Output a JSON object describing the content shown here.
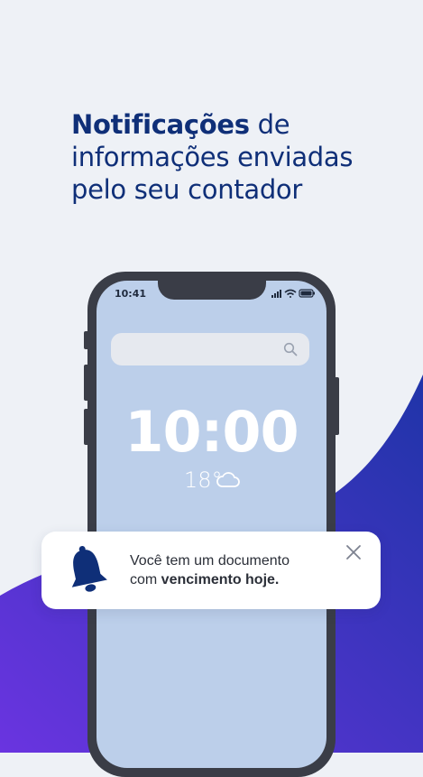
{
  "headline": {
    "bold": "Notificações",
    "rest_first_line": " de",
    "line2": "informações enviadas",
    "line3": "pelo seu contador"
  },
  "phone": {
    "status_time": "10:41",
    "clock": "10:00",
    "temperature": "18°",
    "weather_icon": "cloud-icon"
  },
  "notification": {
    "icon": "bell-icon",
    "text_line1": "Você tem um documento",
    "text_prefix": "com ",
    "text_bold": "vencimento hoje."
  },
  "colors": {
    "headline": "#0f2f78",
    "swoosh_start": "#6a34e0",
    "swoosh_end": "#1f34a8",
    "phone_frame": "#3a3d47",
    "screen": "#bccfea",
    "bell": "#0f2f78"
  }
}
